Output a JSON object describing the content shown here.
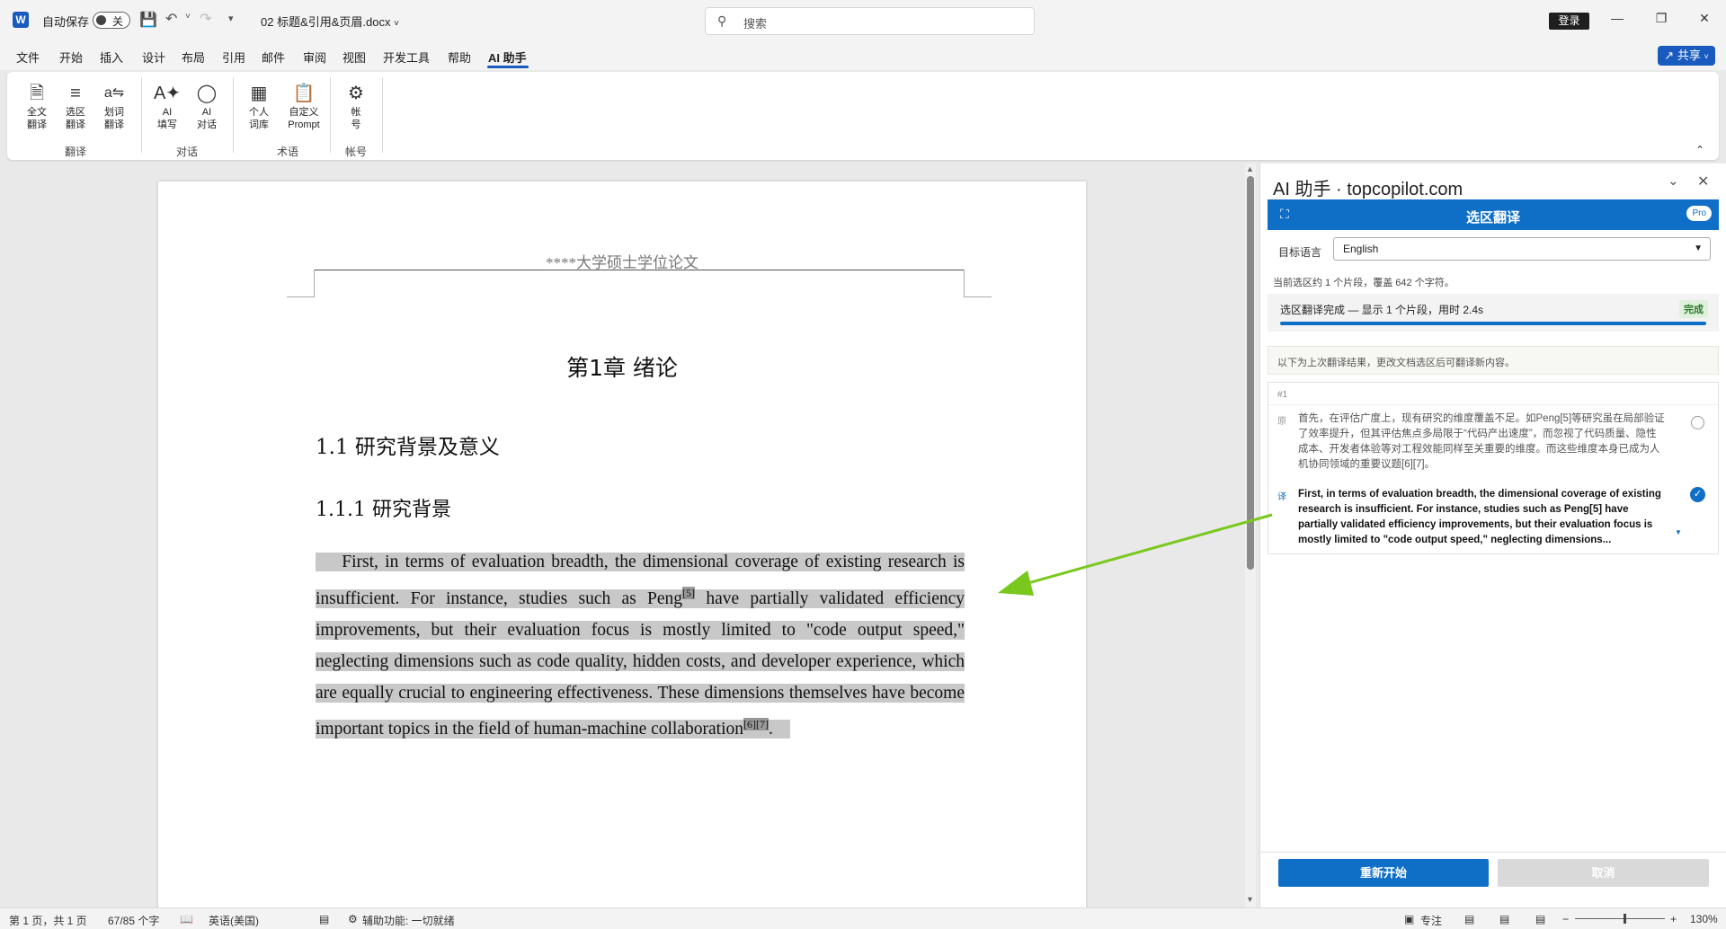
{
  "titlebar": {
    "autosave_label": "自动保存",
    "autosave_state": "关",
    "filename": "02 标题&引用&页眉.docx",
    "search_placeholder": "搜索",
    "login_label": "登录"
  },
  "menu": {
    "items": [
      "文件",
      "开始",
      "插入",
      "设计",
      "布局",
      "引用",
      "邮件",
      "审阅",
      "视图",
      "开发工具",
      "帮助",
      "AI 助手"
    ],
    "active": "AI 助手",
    "share_label": "共享"
  },
  "ribbon": {
    "groups": [
      {
        "label": "翻译",
        "buttons": [
          [
            "全文",
            "翻译"
          ],
          [
            "选区",
            "翻译"
          ],
          [
            "划词",
            "翻译"
          ]
        ]
      },
      {
        "label": "对话",
        "buttons": [
          [
            "AI",
            "填写"
          ],
          [
            "AI",
            "对话"
          ]
        ]
      },
      {
        "label": "术语",
        "buttons": [
          [
            "个人",
            "词库"
          ],
          [
            "自定义",
            "Prompt"
          ]
        ]
      },
      {
        "label": "帐号",
        "buttons": [
          [
            "帐",
            "号"
          ]
        ]
      }
    ]
  },
  "document": {
    "header": "****大学硕士学位论文",
    "chapter": "第1章   绪论",
    "h2": "1.1 研究背景及意义",
    "h3": "1.1.1 研究背景",
    "para_part1": "First, in terms of evaluation breadth, the dimensional coverage of existing research is insufficient. For instance, studies such as Peng",
    "cite1": "[5]",
    "para_part2": " have partially validated efficiency improvements, but their evaluation focus is mostly limited to \"code output speed,\" neglecting dimensions such as code quality, hidden costs, and developer experience, which are equally crucial to engineering effectiveness. These dimensions themselves have become important topics in the field of human-machine collaboration",
    "cite2": "[6][7]",
    "para_end": "."
  },
  "panel": {
    "title": "AI 助手 · topcopilot.com",
    "bar_title": "选区翻译",
    "pro_badge": "Pro",
    "lang_label": "目标语言",
    "lang_value": "English",
    "info": "当前选区约 1 个片段，覆盖 642 个字符。",
    "status": "选区翻译完成 — 显示 1 个片段，用时 2.4s",
    "status_badge": "完成",
    "progress": 1.0,
    "note": "以下为上次翻译结果，更改文档选区后可翻译新内容。",
    "card": {
      "index": "#1",
      "src_tag": "原",
      "src_text": "首先，在评估广度上，现有研究的维度覆盖不足。如Peng[5]等研究虽在局部验证了效率提升，但其评估焦点多局限于“代码产出速度”，而忽视了代码质量、隐性成本、开发者体验等对工程效能同样至关重要的维度。而这些维度本身已成为人机协同领域的重要议题[6][7]。",
      "tgt_tag": "译",
      "tgt_text": "First, in terms of evaluation breadth, the dimensional coverage of existing research is insufficient. For instance, studies such as Peng[5] have partially validated efficiency improvements, but their evaluation focus is mostly limited to \"code output speed,\" neglecting dimensions..."
    },
    "restart_label": "重新开始",
    "cancel_label": "取消"
  },
  "statusbar": {
    "page": "第 1 页，共 1 页",
    "words": "67/85 个字",
    "language": "英语(美国)",
    "accessibility": "辅助功能: 一切就绪",
    "focus": "专注",
    "zoom": "130%"
  },
  "colors": {
    "accent": "#0f6fc6",
    "word_blue": "#185abd",
    "arrow_green": "#7ac81e",
    "selection": "#c8c8c8"
  }
}
